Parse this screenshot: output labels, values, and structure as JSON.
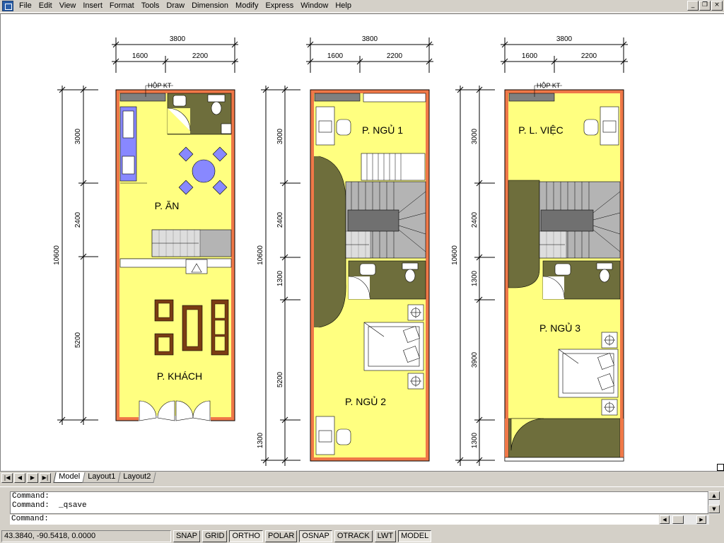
{
  "menu": [
    "File",
    "Edit",
    "View",
    "Insert",
    "Format",
    "Tools",
    "Draw",
    "Dimension",
    "Modify",
    "Express",
    "Window",
    "Help"
  ],
  "window_controls": {
    "minimize": "_",
    "restore": "❐",
    "close": "×"
  },
  "plans": [
    {
      "overall_width": "3800",
      "sub_widths": [
        "1600",
        "2200"
      ],
      "overall_length": "10600",
      "segments": [
        "3000",
        "2400",
        "5200"
      ],
      "label_box": "HỘP KT",
      "rooms": [
        {
          "name": "P. ĂN"
        },
        {
          "name": "P. KHÁCH"
        }
      ]
    },
    {
      "overall_width": "3800",
      "sub_widths": [
        "1600",
        "2200"
      ],
      "overall_length": "10600",
      "segments": [
        "3000",
        "2400",
        "1300",
        "5200",
        "1300"
      ],
      "rooms": [
        {
          "name": "P. NGỦ 1"
        },
        {
          "name": "P. NGỦ 2"
        }
      ]
    },
    {
      "overall_width": "3800",
      "sub_widths": [
        "1600",
        "2200"
      ],
      "overall_length": "10600",
      "segments": [
        "3000",
        "2400",
        "1300",
        "3900",
        "1300"
      ],
      "label_box": "HỘP KT",
      "rooms": [
        {
          "name": "P. L. VIỆC"
        },
        {
          "name": "P. NGỦ 3"
        }
      ]
    }
  ],
  "tabs": [
    "Model",
    "Layout1",
    "Layout2"
  ],
  "command": {
    "history": [
      "Command:",
      "Command:  _qsave"
    ],
    "prompt": "Command:"
  },
  "status": {
    "coords": "43.3840, -90.5418, 0.0000",
    "toggles": [
      {
        "label": "SNAP",
        "on": false
      },
      {
        "label": "GRID",
        "on": false
      },
      {
        "label": "ORTHO",
        "on": true
      },
      {
        "label": "POLAR",
        "on": false
      },
      {
        "label": "OSNAP",
        "on": true
      },
      {
        "label": "OTRACK",
        "on": false
      },
      {
        "label": "LWT",
        "on": false
      },
      {
        "label": "MODEL",
        "on": true
      }
    ]
  },
  "colors": {
    "wall": "#f07848",
    "floor": "#ffff80",
    "olive": "#6e6e3c",
    "stair": "#b4b4b4",
    "purple": "#8888ff",
    "sofa": "#7a3c14"
  }
}
